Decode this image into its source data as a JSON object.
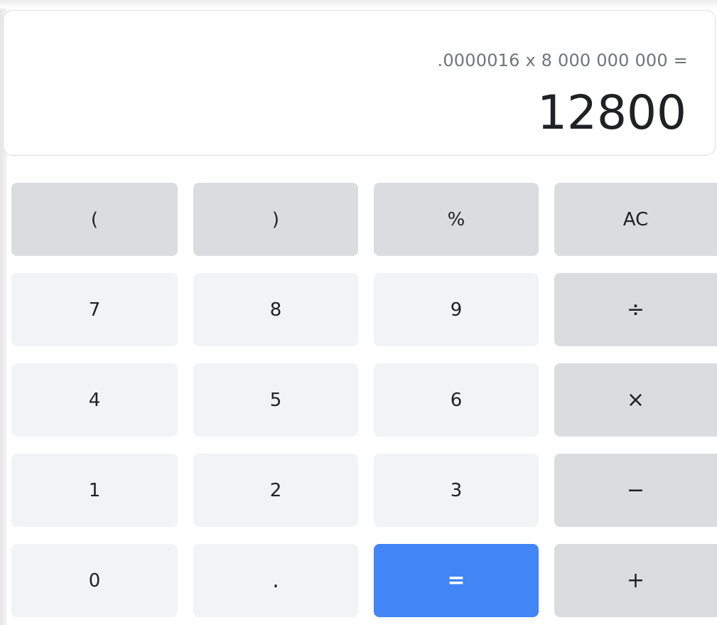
{
  "display": {
    "expression": ".0000016 x 8 000 000 000 =",
    "result": "12800"
  },
  "keys": {
    "open_paren": "(",
    "close_paren": ")",
    "percent": "%",
    "clear": "AC",
    "seven": "7",
    "eight": "8",
    "nine": "9",
    "divide": "÷",
    "four": "4",
    "five": "5",
    "six": "6",
    "multiply": "×",
    "one": "1",
    "two": "2",
    "three": "3",
    "subtract": "−",
    "zero": "0",
    "decimal": ".",
    "equals": "=",
    "add": "+"
  },
  "colors": {
    "operator_key": "#dadce0",
    "number_key": "#f1f3f4",
    "equals_key": "#4285f4",
    "text": "#202124",
    "expression_text": "#70757a"
  }
}
